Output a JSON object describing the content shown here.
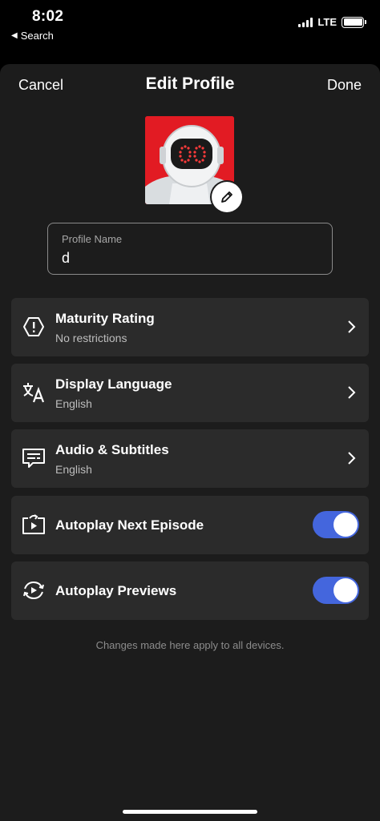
{
  "status_bar": {
    "time": "8:02",
    "back_label": "Search",
    "network": "LTE"
  },
  "nav": {
    "cancel_label": "Cancel",
    "title": "Edit Profile",
    "done_label": "Done"
  },
  "profile_name": {
    "label": "Profile Name",
    "value": "d"
  },
  "settings": [
    {
      "title": "Maturity Rating",
      "subtitle": "No restrictions",
      "icon": "shield-alert-icon"
    },
    {
      "title": "Display Language",
      "subtitle": "English",
      "icon": "translate-icon"
    },
    {
      "title": "Audio & Subtitles",
      "subtitle": "English",
      "icon": "subtitles-icon"
    },
    {
      "title": "Autoplay Next Episode",
      "toggle_on": true,
      "icon": "autoplay-next-icon"
    },
    {
      "title": "Autoplay Previews",
      "toggle_on": true,
      "icon": "autoplay-previews-icon"
    }
  ],
  "footnote": "Changes made here apply to all devices.",
  "colors": {
    "background": "#000000",
    "sheet": "#1c1c1c",
    "row": "#2b2b2b",
    "toggle_on": "#4466dd",
    "avatar_red": "#e21b23"
  }
}
